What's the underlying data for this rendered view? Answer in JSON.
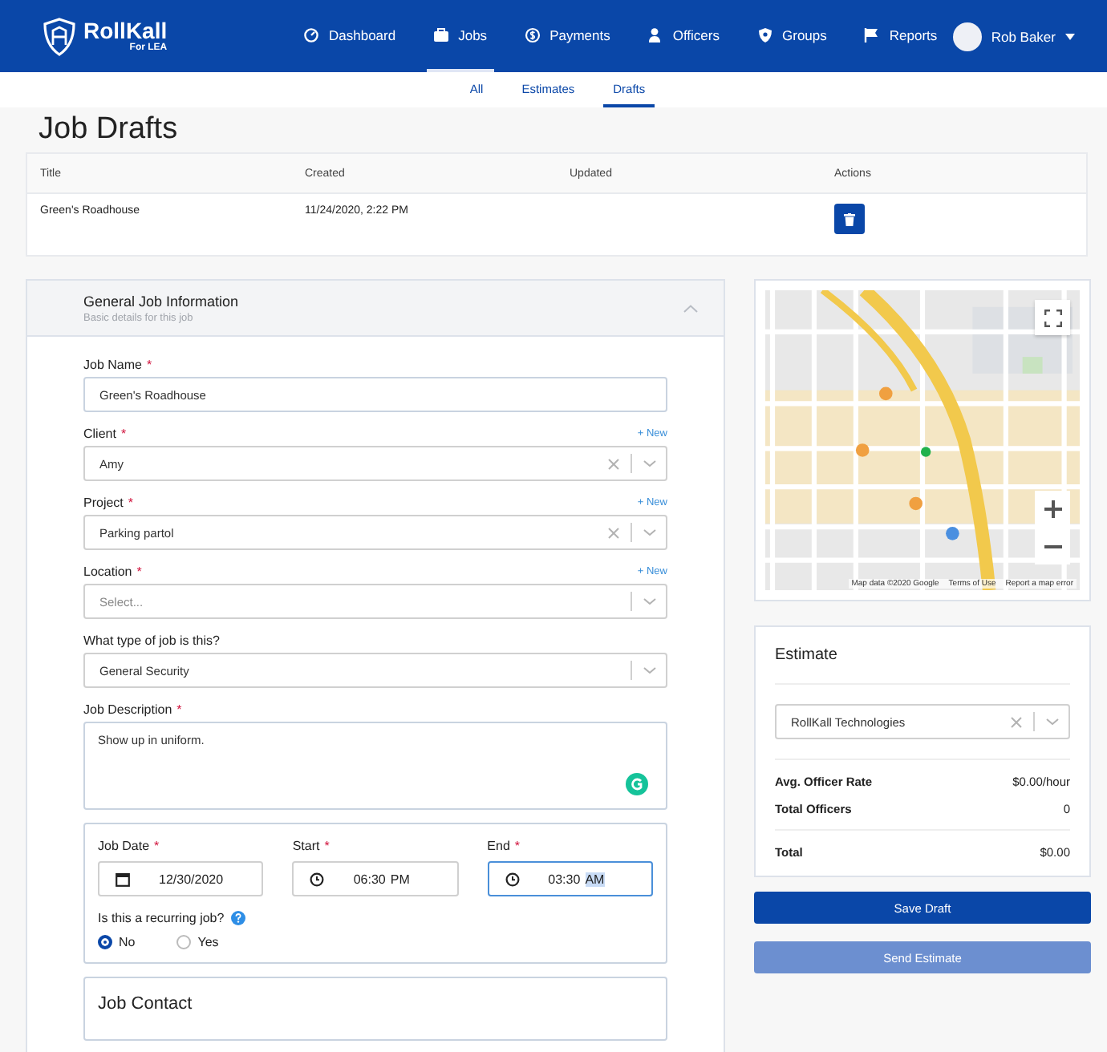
{
  "brand": {
    "name": "RollKall",
    "sub": "For LEA"
  },
  "nav": [
    {
      "label": "Dashboard",
      "selected": false
    },
    {
      "label": "Jobs",
      "selected": true
    },
    {
      "label": "Payments",
      "selected": false
    },
    {
      "label": "Officers",
      "selected": false
    },
    {
      "label": "Groups",
      "selected": false
    },
    {
      "label": "Reports",
      "selected": false
    }
  ],
  "user": {
    "name": "Rob Baker"
  },
  "subtabs": [
    {
      "label": "All",
      "selected": false
    },
    {
      "label": "Estimates",
      "selected": false
    },
    {
      "label": "Drafts",
      "selected": true
    }
  ],
  "page_title": "Job Drafts",
  "drafts_table": {
    "columns": [
      "Title",
      "Created",
      "Updated",
      "Actions"
    ],
    "rows": [
      {
        "title": "Green's Roadhouse",
        "created": "11/24/2020, 2:22 PM"
      }
    ]
  },
  "form": {
    "section": {
      "title": "General Job Information",
      "subtitle": "Basic details for this job",
      "expanded": true
    },
    "fields": [
      {
        "kind": "text",
        "label": "Job Name",
        "required_mark": "*",
        "value": "Green's Roadhouse"
      },
      {
        "kind": "select",
        "label": "Client",
        "required_mark": "*",
        "value": "Amy",
        "clearable": true,
        "new_link": "+ New"
      },
      {
        "kind": "select",
        "label": "Project",
        "required_mark": "*",
        "value": "Parking partol",
        "clearable": true,
        "new_link": "+ New"
      },
      {
        "kind": "select",
        "label": "Location",
        "required_mark": "*",
        "placeholder": "Select...",
        "clearable": false,
        "new_link": "+ New"
      },
      {
        "kind": "select",
        "label": "What type of job is this?",
        "value": "General Security",
        "clearable": false
      },
      {
        "kind": "textarea",
        "label": "Job Description",
        "required_mark": "*",
        "value": "Show up in uniform."
      }
    ],
    "schedule": [
      {
        "kind": "date",
        "label": "Job Date",
        "required_mark": "*",
        "value": "12/30/2020",
        "focused": false
      },
      {
        "kind": "time",
        "label": "Start",
        "required_mark": "*",
        "time": "06:30",
        "period": "PM",
        "focused": false
      },
      {
        "kind": "time",
        "label": "End",
        "required_mark": "*",
        "time": "03:30",
        "period": "AM",
        "focused": true
      }
    ],
    "recurring": {
      "label": "Is this a recurring job?",
      "options": [
        {
          "label": "No",
          "selected": true
        },
        {
          "label": "Yes",
          "selected": false
        }
      ]
    },
    "next_section": {
      "title": "Job Contact"
    }
  },
  "map": {
    "attribution": [
      "Map data ©2020 Google",
      "Terms of Use",
      "Report a map error"
    ]
  },
  "estimate": {
    "title": "Estimate",
    "company": "RollKall Technologies",
    "rows": [
      {
        "label": "Avg. Officer Rate",
        "value": "$0.00/hour"
      },
      {
        "label": "Total Officers",
        "value": "0"
      }
    ],
    "total": {
      "label": "Total",
      "value": "$0.00"
    }
  },
  "buttons": [
    {
      "label": "Save Draft",
      "kind": "primary"
    },
    {
      "label": "Send Estimate",
      "kind": "secondary"
    }
  ]
}
